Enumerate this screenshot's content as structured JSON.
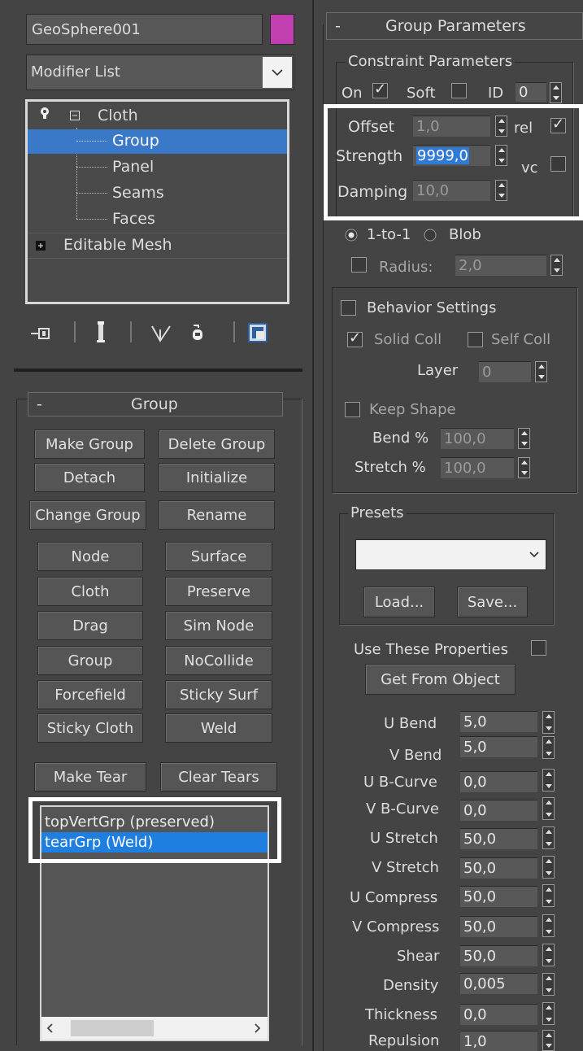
{
  "object": {
    "name": "GeoSphere001",
    "color": "#c23fb2"
  },
  "modifier_list": {
    "value": "Modifier List"
  },
  "stack": {
    "items": [
      {
        "label": "Cloth"
      },
      {
        "label": "Group"
      },
      {
        "label": "Panel"
      },
      {
        "label": "Seams"
      },
      {
        "label": "Faces"
      },
      {
        "label": "Editable Mesh"
      }
    ]
  },
  "toolbar": {
    "icons": [
      "pin-stack-icon",
      "show-end-result-icon",
      "make-unique-icon",
      "remove-modifier-icon",
      "configure-modifier-sets-icon"
    ]
  },
  "group_rollout": {
    "title": "Group",
    "collapse": "-",
    "buttons": [
      "Make Group",
      "Delete Group",
      "Detach",
      "Initialize",
      "Change Group",
      "Rename",
      "Node",
      "Surface",
      "Cloth",
      "Preserve",
      "Drag",
      "Sim Node",
      "Group",
      "NoCollide",
      "Forcefield",
      "Sticky Surf",
      "Sticky Cloth",
      "Weld",
      "Make Tear",
      "Clear Tears"
    ],
    "list": [
      {
        "label": "topVertGrp (preserved)"
      },
      {
        "label": "tearGrp (Weld)"
      }
    ]
  },
  "group_params": {
    "title": "Group Parameters",
    "collapse": "-",
    "constraint": {
      "legend": "Constraint Parameters",
      "on_label": "On",
      "on": true,
      "soft_label": "Soft",
      "soft": false,
      "id_label": "ID",
      "id_value": "0",
      "offset_label": "Offset",
      "offset": "1,0",
      "rel_label": "rel",
      "rel": true,
      "strength_label": "Strength",
      "strength": "9999,0",
      "vc_label": "vc",
      "vc": false,
      "damping_label": "Damping",
      "damping": "10,0"
    },
    "mode": {
      "one_to_one": "1-to-1",
      "blob": "Blob",
      "selected": "1-to-1"
    },
    "radius_label": "Radius:",
    "radius": "2,0",
    "radius_on": false,
    "behavior": {
      "label": "Behavior Settings",
      "on": false,
      "solid_coll_label": "Solid Coll",
      "solid_coll": true,
      "self_coll_label": "Self Coll",
      "self_coll": false,
      "layer_label": "Layer",
      "layer": "0",
      "keep_shape_label": "Keep Shape",
      "keep_shape": false,
      "bend_label": "Bend %",
      "bend": "100,0",
      "stretch_label": "Stretch %",
      "stretch": "100,0"
    },
    "presets": {
      "legend": "Presets",
      "selected": "",
      "load": "Load...",
      "save": "Save..."
    },
    "use_props_label": "Use These Properties",
    "get_from_object": "Get From Object",
    "props": [
      {
        "label": "U Bend",
        "value": "5,0"
      },
      {
        "label": "V Bend",
        "value": "5,0"
      },
      {
        "label": "U B-Curve",
        "value": "0,0"
      },
      {
        "label": "V B-Curve",
        "value": "0,0"
      },
      {
        "label": "U Stretch",
        "value": "50,0"
      },
      {
        "label": "V Stretch",
        "value": "50,0"
      },
      {
        "label": "U Compress",
        "value": "50,0"
      },
      {
        "label": "V Compress",
        "value": "50,0"
      },
      {
        "label": "Shear",
        "value": "50,0"
      },
      {
        "label": "Density",
        "value": "0,005"
      },
      {
        "label": "Thickness",
        "value": "0,0"
      },
      {
        "label": "Repulsion",
        "value": "1,0"
      }
    ]
  }
}
